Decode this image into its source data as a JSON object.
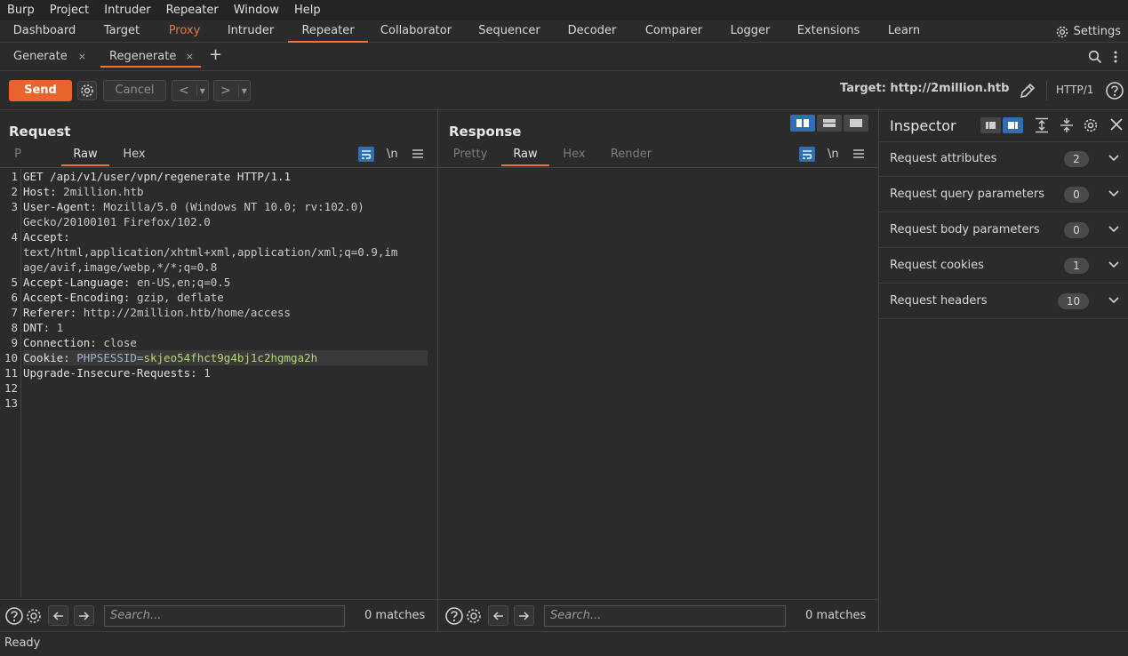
{
  "menu": [
    "Burp",
    "Project",
    "Intruder",
    "Repeater",
    "Window",
    "Help"
  ],
  "tools": {
    "tabs": [
      "Dashboard",
      "Target",
      "Proxy",
      "Intruder",
      "Repeater",
      "Collaborator",
      "Sequencer",
      "Decoder",
      "Comparer",
      "Logger",
      "Extensions",
      "Learn"
    ],
    "active": "Repeater",
    "highlighted": "Proxy",
    "settings_label": "Settings"
  },
  "repeater_tabs": [
    {
      "label": "Generate",
      "close": "×"
    },
    {
      "label": "Regenerate",
      "close": "×"
    }
  ],
  "add_tab": "+",
  "actions": {
    "send": "Send",
    "cancel": "Cancel",
    "prev": "<",
    "next": ">",
    "dropdown": "▾",
    "target": "Target: http://2million.htb",
    "protocol": "HTTP/1"
  },
  "request": {
    "title": "Request",
    "tabs": [
      "P",
      "Raw",
      "Hex"
    ],
    "active_tab": "Raw",
    "newline_toggle": "\\n",
    "lines": [
      {
        "n": "1",
        "name": "GET /api/v1/user/vpn/regenerate HTTP/1.1",
        "value": ""
      },
      {
        "n": "2",
        "name": "Host:",
        "value": " 2million.htb"
      },
      {
        "n": "3",
        "name": "User-Agent:",
        "value": " Mozilla/5.0 (Windows NT 10.0; rv:102.0)"
      },
      {
        "n": "",
        "name": "",
        "value": "Gecko/20100101 Firefox/102.0"
      },
      {
        "n": "4",
        "name": "Accept:",
        "value": ""
      },
      {
        "n": "",
        "name": "",
        "value": "text/html,application/xhtml+xml,application/xml;q=0.9,im"
      },
      {
        "n": "",
        "name": "",
        "value": "age/avif,image/webp,*/*;q=0.8"
      },
      {
        "n": "5",
        "name": "Accept-Language:",
        "value": " en-US,en;q=0.5"
      },
      {
        "n": "6",
        "name": "Accept-Encoding:",
        "value": " gzip, deflate"
      },
      {
        "n": "7",
        "name": "Referer:",
        "value": " http://2million.htb/home/access"
      },
      {
        "n": "8",
        "name": "DNT:",
        "value": " 1"
      },
      {
        "n": "9",
        "name": "Connection:",
        "value": " close"
      },
      {
        "n": "10",
        "name": "Cookie:",
        "cookie_key": " PHPSESSID=",
        "cookie_value": "skjeo54fhct9g4bj1c2hgmga2h"
      },
      {
        "n": "11",
        "name": "Upgrade-Insecure-Requests:",
        "value": " 1"
      },
      {
        "n": "12",
        "name": "",
        "value": ""
      },
      {
        "n": "13",
        "name": "",
        "value": ""
      }
    ],
    "search_placeholder": "Search...",
    "matches": "0 matches"
  },
  "response": {
    "title": "Response",
    "tabs": [
      "Pretty",
      "Raw",
      "Hex",
      "Render"
    ],
    "active_tab": "Raw",
    "newline_toggle": "\\n",
    "search_placeholder": "Search...",
    "matches": "0 matches"
  },
  "inspector": {
    "title": "Inspector",
    "sections": [
      {
        "label": "Request attributes",
        "count": "2"
      },
      {
        "label": "Request query parameters",
        "count": "0"
      },
      {
        "label": "Request body parameters",
        "count": "0"
      },
      {
        "label": "Request cookies",
        "count": "1"
      },
      {
        "label": "Request headers",
        "count": "10"
      }
    ]
  },
  "status": "Ready",
  "colors": {
    "accent": "#e8753a",
    "send_button": "#e8642a",
    "layout_toggle_active": "#2f6db5",
    "background": "#2b2b2b"
  }
}
